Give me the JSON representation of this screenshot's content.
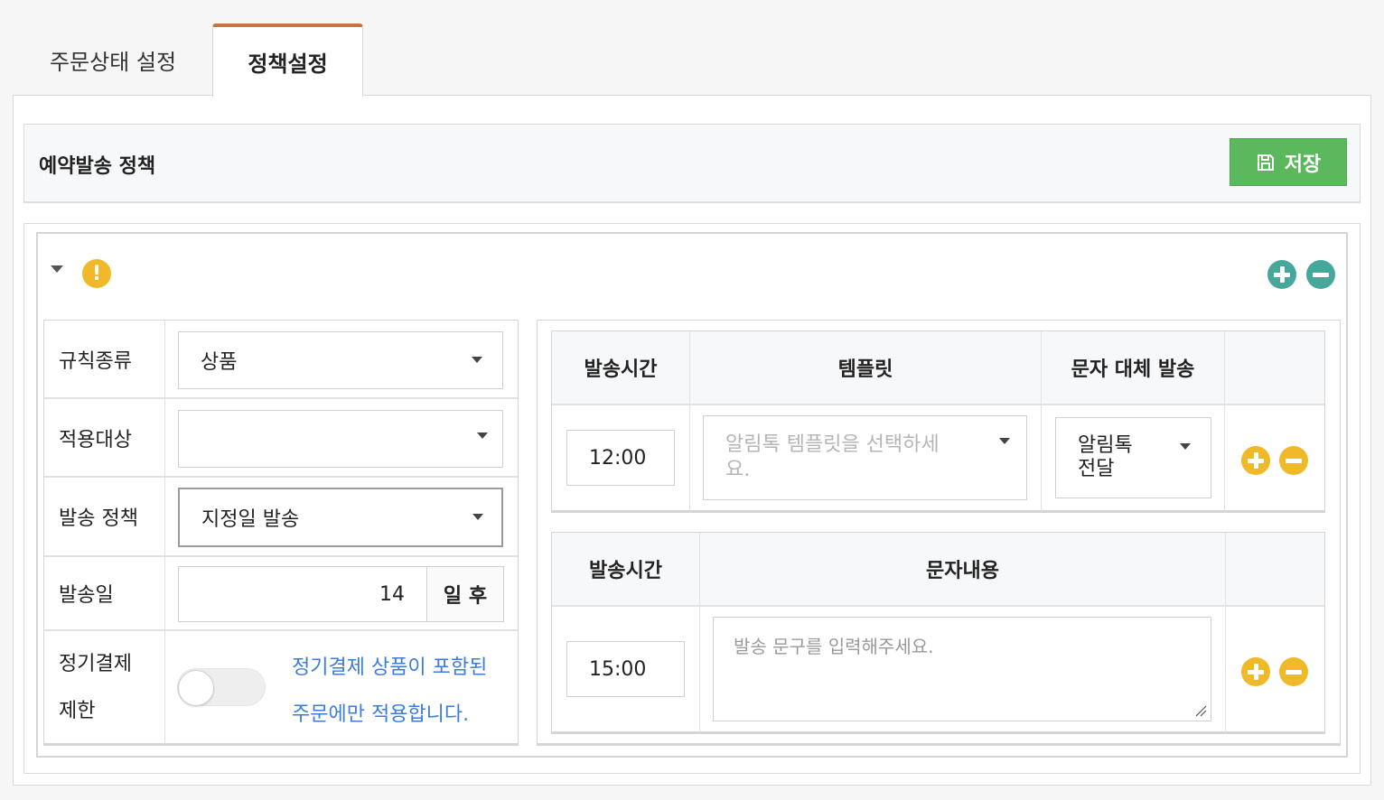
{
  "tabs": [
    {
      "label": "주문상태 설정",
      "active": false
    },
    {
      "label": "정책설정",
      "active": true
    }
  ],
  "header": {
    "title": "예약발송 정책",
    "save_label": "저장"
  },
  "rule": {
    "fields": {
      "rule_type": {
        "label": "규칙종류",
        "value": "상품"
      },
      "target": {
        "label": "적용대상",
        "value": ""
      },
      "send_policy": {
        "label": "발송 정책",
        "value": "지정일 발송"
      },
      "send_day": {
        "label": "발송일",
        "value": "14",
        "suffix": "일 후"
      },
      "subscription": {
        "label_line1": "정기결제",
        "label_line2": "제한",
        "enabled": false,
        "desc_line1": "정기결제 상품이 포함된",
        "desc_line2": "주문에만 적용합니다."
      }
    },
    "alimtalk_table": {
      "headers": [
        "발송시간",
        "템플릿",
        "문자 대체 발송"
      ],
      "rows": [
        {
          "time": "12:00",
          "template_placeholder_line1": "알림톡 템플릿을 선택하세",
          "template_placeholder_line2": "요.",
          "fallback_line1": "알림톡",
          "fallback_line2": "전달"
        }
      ]
    },
    "sms_table": {
      "headers": [
        "발송시간",
        "문자내용"
      ],
      "rows": [
        {
          "time": "15:00",
          "message_placeholder": "발송 문구를 입력해주세요."
        }
      ]
    }
  },
  "colors": {
    "accent_tab": "#c8743a",
    "save_button": "#5cb85c",
    "teal_icon": "#46a89a",
    "yellow_icon": "#f0b92a",
    "link_blue": "#3b7dd8"
  },
  "icons": [
    "save-icon",
    "warning-icon",
    "add-icon",
    "remove-icon",
    "dropdown-caret-icon",
    "collapse-caret-icon",
    "resize-handle-icon"
  ]
}
